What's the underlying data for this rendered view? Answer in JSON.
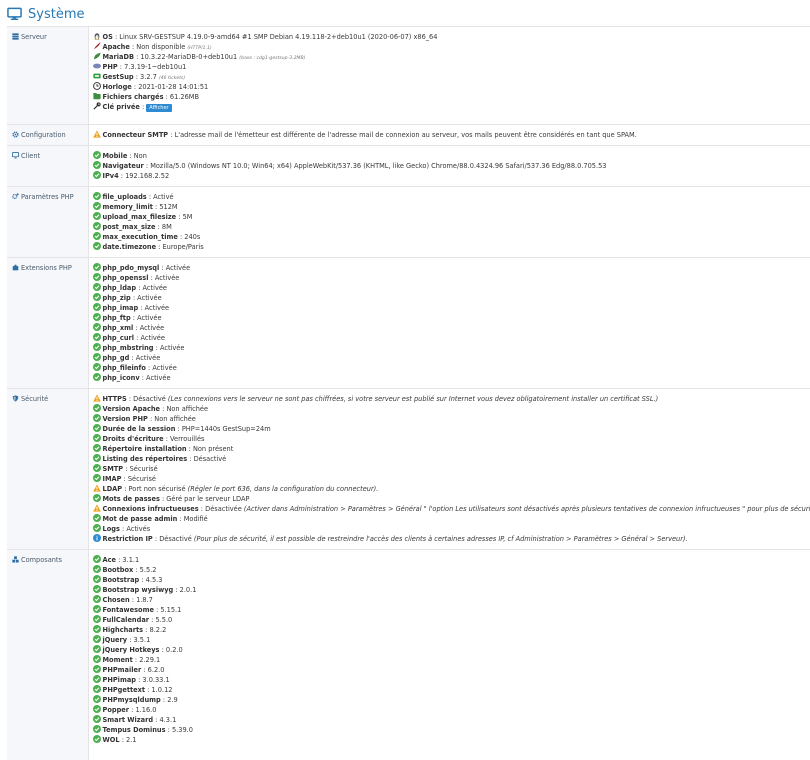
{
  "page": {
    "title": "Système"
  },
  "sections": {
    "serveur": {
      "label": "Serveur",
      "lines": [
        {
          "key": "OS",
          "value": "Linux SRV-GESTSUP 4.19.0-9-amd64 #1 SMP Debian 4.19.118-2+deb10u1 (2020-06-07) x86_64",
          "icon": "linux-icon",
          "color": "#555555"
        },
        {
          "key": "Apache",
          "value": "Non disponible",
          "note": "(HTTP/1.1)",
          "icon": "feather-icon",
          "color": "#a0262d"
        },
        {
          "key": "MariaDB",
          "value": "10.3.22-MariaDB-0+deb10u1",
          "note": "(base : cdg1-gestsup-3.2MB)",
          "icon": "database-leaf-icon",
          "color": "#3c8c3c"
        },
        {
          "key": "PHP",
          "value": "7.3.19-1~deb10u1",
          "icon": "php-icon",
          "color": "#7a86b8"
        },
        {
          "key": "GestSup",
          "value": "3.2.7",
          "note": "(46 tickets)",
          "icon": "ticket-icon",
          "color": "#2e9e3e"
        },
        {
          "key": "Horloge",
          "value": "2021-01-28 14:01:51",
          "icon": "clock-icon",
          "color": "#333333"
        },
        {
          "key": "Fichiers chargés",
          "value": "61.26MB",
          "icon": "files-icon",
          "color": "#3f8f3f"
        },
        {
          "key": "Clé privée",
          "value": "",
          "button": "Afficher",
          "icon": "key-icon",
          "color": "#333333"
        }
      ]
    },
    "configuration": {
      "label": "Configuration",
      "lines": [
        {
          "key": "Connecteur SMTP",
          "value": "L'adresse mail de l'émetteur est différente de l'adresse mail de connexion au serveur, vos mails peuvent être considérés en tant que SPAM.",
          "icon": "warning-icon",
          "color": "#f0a020"
        }
      ]
    },
    "client": {
      "label": "Client",
      "lines": [
        {
          "key": "Mobile",
          "value": "Non",
          "icon": "check-circle-icon",
          "color": "#4caf50"
        },
        {
          "key": "Navigateur",
          "value": "Mozilla/5.0 (Windows NT 10.0; Win64; x64) AppleWebKit/537.36 (KHTML, like Gecko) Chrome/88.0.4324.96 Safari/537.36 Edg/88.0.705.53",
          "icon": "check-circle-icon",
          "color": "#4caf50"
        },
        {
          "key": "IPv4",
          "value": "192.168.2.52",
          "icon": "check-circle-icon",
          "color": "#4caf50"
        }
      ]
    },
    "parametres_php": {
      "label": "Paramètres PHP",
      "lines": [
        {
          "key": "file_uploads",
          "value": "Activé",
          "icon": "check-circle-icon",
          "color": "#4caf50"
        },
        {
          "key": "memory_limit",
          "value": "512M",
          "icon": "check-circle-icon",
          "color": "#4caf50"
        },
        {
          "key": "upload_max_filesize",
          "value": "5M",
          "icon": "check-circle-icon",
          "color": "#4caf50"
        },
        {
          "key": "post_max_size",
          "value": "8M",
          "icon": "check-circle-icon",
          "color": "#4caf50"
        },
        {
          "key": "max_execution_time",
          "value": "240s",
          "icon": "check-circle-icon",
          "color": "#4caf50"
        },
        {
          "key": "date.timezone",
          "value": "Europe/Paris",
          "icon": "check-circle-icon",
          "color": "#4caf50"
        }
      ]
    },
    "extensions_php": {
      "label": "Extensions PHP",
      "lines": [
        {
          "key": "php_pdo_mysql",
          "value": "Activée",
          "icon": "check-circle-icon",
          "color": "#4caf50"
        },
        {
          "key": "php_openssl",
          "value": "Activée",
          "icon": "check-circle-icon",
          "color": "#4caf50"
        },
        {
          "key": "php_ldap",
          "value": "Activée",
          "icon": "check-circle-icon",
          "color": "#4caf50"
        },
        {
          "key": "php_zip",
          "value": "Activée",
          "icon": "check-circle-icon",
          "color": "#4caf50"
        },
        {
          "key": "php_imap",
          "value": "Activée",
          "icon": "check-circle-icon",
          "color": "#4caf50"
        },
        {
          "key": "php_ftp",
          "value": "Activée",
          "icon": "check-circle-icon",
          "color": "#4caf50"
        },
        {
          "key": "php_xml",
          "value": "Activée",
          "icon": "check-circle-icon",
          "color": "#4caf50"
        },
        {
          "key": "php_curl",
          "value": "Activée",
          "icon": "check-circle-icon",
          "color": "#4caf50"
        },
        {
          "key": "php_mbstring",
          "value": "Activée",
          "icon": "check-circle-icon",
          "color": "#4caf50"
        },
        {
          "key": "php_gd",
          "value": "Activée",
          "icon": "check-circle-icon",
          "color": "#4caf50"
        },
        {
          "key": "php_fileinfo",
          "value": "Activée",
          "icon": "check-circle-icon",
          "color": "#4caf50"
        },
        {
          "key": "php_iconv",
          "value": "Activée",
          "icon": "check-circle-icon",
          "color": "#4caf50"
        }
      ]
    },
    "securite": {
      "label": "Sécurité",
      "lines": [
        {
          "key": "HTTPS",
          "value": "Désactivé",
          "note": "(Les connexions vers le serveur ne sont pas chiffrées, si votre serveur est publié sur Internet vous devez obligatoirement installer un certificat SSL.)",
          "icon": "warning-icon",
          "color": "#f0a020"
        },
        {
          "key": "Version Apache",
          "value": "Non affichée",
          "icon": "check-circle-icon",
          "color": "#4caf50"
        },
        {
          "key": "Version PHP",
          "value": "Non affichée",
          "icon": "check-circle-icon",
          "color": "#4caf50"
        },
        {
          "key": "Durée de la session",
          "value": "PHP=1440s GestSup=24m",
          "icon": "check-circle-icon",
          "color": "#4caf50"
        },
        {
          "key": "Droits d'écriture",
          "value": "Verrouillés",
          "icon": "check-circle-icon",
          "color": "#4caf50"
        },
        {
          "key": "Répertoire installation",
          "value": "Non présent",
          "icon": "check-circle-icon",
          "color": "#4caf50"
        },
        {
          "key": "Listing des répertoires",
          "value": "Désactivé",
          "icon": "check-circle-icon",
          "color": "#4caf50"
        },
        {
          "key": "SMTP",
          "value": "Sécurisé",
          "icon": "check-circle-icon",
          "color": "#4caf50"
        },
        {
          "key": "IMAP",
          "value": "Sécurisé",
          "icon": "check-circle-icon",
          "color": "#4caf50"
        },
        {
          "key": "LDAP",
          "value": "Port non sécurisé",
          "note": "(Régler le port 636, dans la configuration du connecteur).",
          "icon": "warning-icon",
          "color": "#f0a020"
        },
        {
          "key": "Mots de passes",
          "value": "Géré par le serveur LDAP",
          "icon": "check-circle-icon",
          "color": "#4caf50"
        },
        {
          "key": "Connexions infructueuses",
          "value": "Désactivée",
          "note": "(Activer dans Administration > Paramètres > Général \" l'option Les utilisateurs sont désactivés après plusieurs tentatives de connexion infructueuses \" pour plus de sécurité).",
          "icon": "warning-icon",
          "color": "#f0a020"
        },
        {
          "key": "Mot de passe admin",
          "value": "Modifié",
          "icon": "check-circle-icon",
          "color": "#4caf50"
        },
        {
          "key": "Logs",
          "value": "Activés",
          "icon": "check-circle-icon",
          "color": "#4caf50"
        },
        {
          "key": "Restriction IP",
          "value": "Désactivé",
          "note": "(Pour plus de sécurité, il est possible de restreindre l'accès des clients à certaines adresses IP, cf Administration > Paramètres > Général > Serveur).",
          "icon": "info-circle-icon",
          "color": "#2e8bd1"
        }
      ]
    },
    "composants": {
      "label": "Composants",
      "lines": [
        {
          "key": "Ace",
          "value": "3.1.1",
          "icon": "check-circle-icon",
          "color": "#4caf50"
        },
        {
          "key": "Bootbox",
          "value": "5.5.2",
          "icon": "check-circle-icon",
          "color": "#4caf50"
        },
        {
          "key": "Bootstrap",
          "value": "4.5.3",
          "icon": "check-circle-icon",
          "color": "#4caf50"
        },
        {
          "key": "Bootstrap wysiwyg",
          "value": "2.0.1",
          "icon": "check-circle-icon",
          "color": "#4caf50"
        },
        {
          "key": "Chosen",
          "value": "1.8.7",
          "icon": "check-circle-icon",
          "color": "#4caf50"
        },
        {
          "key": "Fontawesome",
          "value": "5.15.1",
          "icon": "check-circle-icon",
          "color": "#4caf50"
        },
        {
          "key": "FullCalendar",
          "value": "5.5.0",
          "icon": "check-circle-icon",
          "color": "#4caf50"
        },
        {
          "key": "Highcharts",
          "value": "8.2.2",
          "icon": "check-circle-icon",
          "color": "#4caf50"
        },
        {
          "key": "jQuery",
          "value": "3.5.1",
          "icon": "check-circle-icon",
          "color": "#4caf50"
        },
        {
          "key": "jQuery Hotkeys",
          "value": "0.2.0",
          "icon": "check-circle-icon",
          "color": "#4caf50"
        },
        {
          "key": "Moment",
          "value": "2.29.1",
          "icon": "check-circle-icon",
          "color": "#4caf50"
        },
        {
          "key": "PHPmailer",
          "value": "6.2.0",
          "icon": "check-circle-icon",
          "color": "#4caf50"
        },
        {
          "key": "PHPimap",
          "value": "3.0.33.1",
          "icon": "check-circle-icon",
          "color": "#4caf50"
        },
        {
          "key": "PHPgettext",
          "value": "1.0.12",
          "icon": "check-circle-icon",
          "color": "#4caf50"
        },
        {
          "key": "PHPmysqldump",
          "value": "2.9",
          "icon": "check-circle-icon",
          "color": "#4caf50"
        },
        {
          "key": "Popper",
          "value": "1.16.0",
          "icon": "check-circle-icon",
          "color": "#4caf50"
        },
        {
          "key": "Smart Wizard",
          "value": "4.3.1",
          "icon": "check-circle-icon",
          "color": "#4caf50"
        },
        {
          "key": "Tempus Dominus",
          "value": "5.39.0",
          "icon": "check-circle-icon",
          "color": "#4caf50"
        },
        {
          "key": "WOL",
          "value": "2.1",
          "icon": "check-circle-icon",
          "color": "#4caf50"
        }
      ]
    }
  },
  "section_icons": {
    "serveur": "server-icon",
    "configuration": "gear-icon",
    "client": "desktop-icon",
    "parametres_php": "gears-icon",
    "extensions_php": "puzzle-icon",
    "securite": "shield-icon",
    "composants": "cubes-icon"
  },
  "colors": {
    "accent": "#2679b5",
    "label_text": "#4a5a6b",
    "ok": "#4caf50",
    "warning": "#f0a020",
    "info": "#2e8bd1"
  }
}
